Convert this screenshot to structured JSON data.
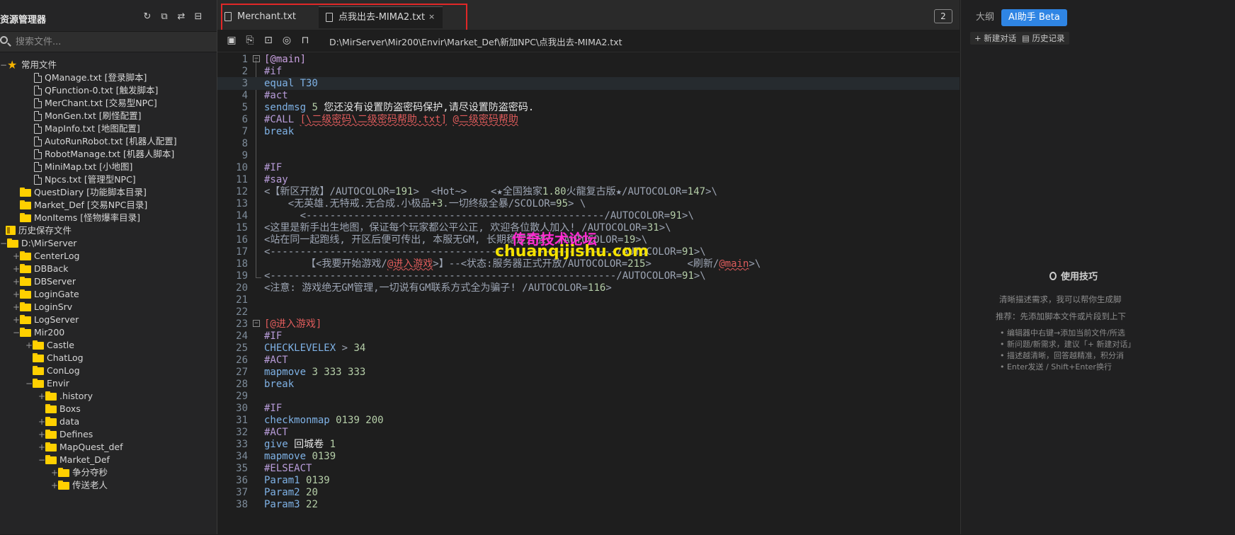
{
  "sidebar": {
    "title": "资源管理器",
    "search_placeholder": "搜索文件...",
    "items": [
      {
        "label": "常用文件",
        "icon": "star",
        "toggle": "−"
      },
      {
        "label": "QManage.txt [登录脚本]",
        "icon": "file"
      },
      {
        "label": "QFunction-0.txt [触发脚本]",
        "icon": "file"
      },
      {
        "label": "MerChant.txt [交易型NPC]",
        "icon": "file"
      },
      {
        "label": "MonGen.txt [刷怪配置]",
        "icon": "file"
      },
      {
        "label": "MapInfo.txt [地图配置]",
        "icon": "file"
      },
      {
        "label": "AutoRunRobot.txt [机器人配置]",
        "icon": "file"
      },
      {
        "label": "RobotManage.txt [机器人脚本]",
        "icon": "file"
      },
      {
        "label": "MiniMap.txt [小地图]",
        "icon": "file"
      },
      {
        "label": "Npcs.txt [管理型NPC]",
        "icon": "file"
      },
      {
        "label": "QuestDiary [功能脚本目录]",
        "icon": "folder"
      },
      {
        "label": "Market_Def [交易NPC目录]",
        "icon": "folder"
      },
      {
        "label": "MonItems [怪物爆率目录]",
        "icon": "folder"
      },
      {
        "label": "历史保存文件",
        "icon": "history"
      },
      {
        "label": "D:\\MirServer",
        "icon": "folder",
        "toggle": "−"
      },
      {
        "label": "CenterLog",
        "icon": "folder",
        "toggle": "+"
      },
      {
        "label": "DBBack",
        "icon": "folder",
        "toggle": "+"
      },
      {
        "label": "DBServer",
        "icon": "folder",
        "toggle": "+"
      },
      {
        "label": "LoginGate",
        "icon": "folder",
        "toggle": "+"
      },
      {
        "label": "LoginSrv",
        "icon": "folder",
        "toggle": "+"
      },
      {
        "label": "LogServer",
        "icon": "folder",
        "toggle": "+"
      },
      {
        "label": "Mir200",
        "icon": "folder",
        "toggle": "−"
      },
      {
        "label": "Castle",
        "icon": "folder",
        "toggle": "+"
      },
      {
        "label": "ChatLog",
        "icon": "folder"
      },
      {
        "label": "ConLog",
        "icon": "folder"
      },
      {
        "label": "Envir",
        "icon": "folder",
        "toggle": "−"
      },
      {
        "label": ".history",
        "icon": "folder",
        "toggle": "+"
      },
      {
        "label": "Boxs",
        "icon": "folder"
      },
      {
        "label": "data",
        "icon": "folder",
        "toggle": "+"
      },
      {
        "label": "Defines",
        "icon": "folder",
        "toggle": "+"
      },
      {
        "label": "MapQuest_def",
        "icon": "folder",
        "toggle": "+"
      },
      {
        "label": "Market_Def",
        "icon": "folder",
        "toggle": "−"
      },
      {
        "label": "争分夺秒",
        "icon": "folder",
        "toggle": "+"
      },
      {
        "label": "传送老人",
        "icon": "folder",
        "toggle": "+"
      }
    ]
  },
  "editor": {
    "tabs": [
      {
        "label": "Merchant.txt"
      },
      {
        "label": "点我出去-MIMA2.txt"
      }
    ],
    "tab_close": "×",
    "open_count": "2",
    "file_path": "D:\\MirServer\\Mir200\\Envir\\Market_Def\\新加NPC\\点我出去-MIMA2.txt",
    "watermark_1": "传奇技术论坛",
    "watermark_2": "chuanqijishu.com",
    "lines": [
      {
        "n": "1",
        "fold": "−",
        "t": [
          [
            "[@main]",
            "c-lab"
          ]
        ]
      },
      {
        "n": "2",
        "t": [
          [
            "#if",
            "c-dir"
          ]
        ]
      },
      {
        "n": "3",
        "cur": true,
        "t": [
          [
            "equal T30",
            "c-kw"
          ]
        ]
      },
      {
        "n": "4",
        "t": [
          [
            "#act",
            "c-dir"
          ]
        ]
      },
      {
        "n": "5",
        "t": [
          [
            "sendmsg ",
            "c-kw"
          ],
          [
            "5",
            "c-num"
          ],
          [
            " 您还没有设置防盗密码保护,请尽设置防盗密码.",
            "c-wht"
          ]
        ]
      },
      {
        "n": "6",
        "t": [
          [
            "#CALL ",
            "c-dir"
          ],
          [
            "[\\二级密码\\二级密码帮助.txt]",
            "c-red c-sq"
          ],
          [
            " ",
            "c-wht"
          ],
          [
            "@二级密码帮助",
            "c-red c-sq"
          ]
        ]
      },
      {
        "n": "7",
        "t": [
          [
            "break",
            "c-kw"
          ]
        ]
      },
      {
        "n": "8",
        "t": []
      },
      {
        "n": "9",
        "t": []
      },
      {
        "n": "10",
        "t": [
          [
            "#IF",
            "c-dir"
          ]
        ]
      },
      {
        "n": "11",
        "t": [
          [
            "#say",
            "c-dir"
          ]
        ]
      },
      {
        "n": "12",
        "t": [
          [
            "<【新区开放】/AUTOCOLOR=",
            "c-gry"
          ],
          [
            "191",
            "c-num"
          ],
          [
            ">  <Hot~>    <★全国独家",
            "c-gry"
          ],
          [
            "1.80",
            "c-num"
          ],
          [
            "火龍复古版★/AUTOCOLOR=",
            "c-gry"
          ],
          [
            "147",
            "c-num"
          ],
          [
            ">\\",
            "c-gry"
          ]
        ]
      },
      {
        "n": "13",
        "t": [
          [
            "    <无英雄.无特戒.无合成.小极品",
            "c-gry"
          ],
          [
            "+3",
            "c-num"
          ],
          [
            ".一切终级全暴/SCOLOR=",
            "c-gry"
          ],
          [
            "95",
            "c-num"
          ],
          [
            "> \\",
            "c-gry"
          ]
        ]
      },
      {
        "n": "14",
        "t": [
          [
            "      <--------------------------------------------------/AUTOCOLOR=",
            "c-gry"
          ],
          [
            "91",
            "c-num"
          ],
          [
            ">\\",
            "c-gry"
          ]
        ]
      },
      {
        "n": "15",
        "t": [
          [
            "<这里是新手出生地图，保证每个玩家都公平公正, 欢迎各位散人加入! /AUTOCOLOR=",
            "c-gry"
          ],
          [
            "31",
            "c-num"
          ],
          [
            ">\\",
            "c-gry"
          ]
        ]
      },
      {
        "n": "16",
        "t": [
          [
            "<站在同一起跑线, 开区后便可传出, 本服无GM, 长期稳定开放! /AUTOCOLOR=",
            "c-gry"
          ],
          [
            "19",
            "c-num"
          ],
          [
            ">\\",
            "c-gry"
          ]
        ]
      },
      {
        "n": "17",
        "t": [
          [
            "<----------------------------------------------------------/AUTOCOLOR=",
            "c-gry"
          ],
          [
            "91",
            "c-num"
          ],
          [
            ">\\",
            "c-gry"
          ]
        ]
      },
      {
        "n": "18",
        "t": [
          [
            "       【<我要开始游戏/",
            "c-gry"
          ],
          [
            "@进入游戏",
            "c-red c-sq"
          ],
          [
            ">】--<状态:服务器正式开放/AUTOCOLOR=",
            "c-gry"
          ],
          [
            "215",
            "c-num"
          ],
          [
            ">      <刷新/",
            "c-gry"
          ],
          [
            "@main",
            "c-red c-sq"
          ],
          [
            ">\\",
            "c-gry"
          ]
        ]
      },
      {
        "n": "19",
        "t": [
          [
            "<----------------------------------------------------------/AUTOCOLOR=",
            "c-gry"
          ],
          [
            "91",
            "c-num"
          ],
          [
            ">\\",
            "c-gry"
          ]
        ]
      },
      {
        "n": "20",
        "t": [
          [
            "<注意: 游戏绝无GM管理,一切说有GM联系方式全为骗子! /AUTOCOLOR=",
            "c-gry"
          ],
          [
            "116",
            "c-num"
          ],
          [
            ">",
            "c-gry"
          ]
        ]
      },
      {
        "n": "21",
        "t": []
      },
      {
        "n": "22",
        "t": []
      },
      {
        "n": "23",
        "fold": "−",
        "t": [
          [
            "[@进入游戏]",
            "c-red"
          ]
        ]
      },
      {
        "n": "24",
        "t": [
          [
            "#IF",
            "c-dir"
          ]
        ]
      },
      {
        "n": "25",
        "t": [
          [
            "CHECKLEVELEX",
            "c-kw"
          ],
          [
            " > ",
            "c-gry"
          ],
          [
            "34",
            "c-num"
          ]
        ]
      },
      {
        "n": "26",
        "t": [
          [
            "#ACT",
            "c-dir"
          ]
        ]
      },
      {
        "n": "27",
        "t": [
          [
            "mapmove ",
            "c-kw"
          ],
          [
            "3 333 333",
            "c-num"
          ]
        ]
      },
      {
        "n": "28",
        "t": [
          [
            "break",
            "c-kw"
          ]
        ]
      },
      {
        "n": "29",
        "t": []
      },
      {
        "n": "30",
        "t": [
          [
            "#IF",
            "c-dir"
          ]
        ]
      },
      {
        "n": "31",
        "t": [
          [
            "checkmonmap ",
            "c-kw"
          ],
          [
            "0139 200",
            "c-num"
          ]
        ]
      },
      {
        "n": "32",
        "t": [
          [
            "#ACT",
            "c-dir"
          ]
        ]
      },
      {
        "n": "33",
        "t": [
          [
            "give ",
            "c-kw"
          ],
          [
            "回城卷 ",
            "c-wht"
          ],
          [
            "1",
            "c-num"
          ]
        ]
      },
      {
        "n": "34",
        "t": [
          [
            "mapmove ",
            "c-kw"
          ],
          [
            "0139",
            "c-num"
          ]
        ]
      },
      {
        "n": "35",
        "t": [
          [
            "#ELSEACT",
            "c-dir"
          ]
        ]
      },
      {
        "n": "36",
        "t": [
          [
            "Param1 ",
            "c-kw"
          ],
          [
            "0139",
            "c-num"
          ]
        ]
      },
      {
        "n": "37",
        "t": [
          [
            "Param2 ",
            "c-kw"
          ],
          [
            "20",
            "c-num"
          ]
        ]
      },
      {
        "n": "38",
        "t": [
          [
            "Param3 ",
            "c-kw"
          ],
          [
            "22",
            "c-num"
          ]
        ]
      }
    ]
  },
  "right_panel": {
    "tab_outline": "大纲",
    "tab_ai": "AI助手 Beta",
    "new_chat": "+ 新建对话",
    "history": "历史记录",
    "tips_title": "使用技巧",
    "tip_main": "清晰描述需求，我可以帮你生成脚",
    "tip_recommend": "推荐：先添加脚本文件或片段到上下",
    "tip_list": [
      "• 编辑器中右键→添加当前文件/所选",
      "• 新问题/新需求，建议「+ 新建对话」",
      "• 描述越清晰，回答越精准，积分消",
      "• Enter发送 / Shift+Enter换行"
    ]
  }
}
